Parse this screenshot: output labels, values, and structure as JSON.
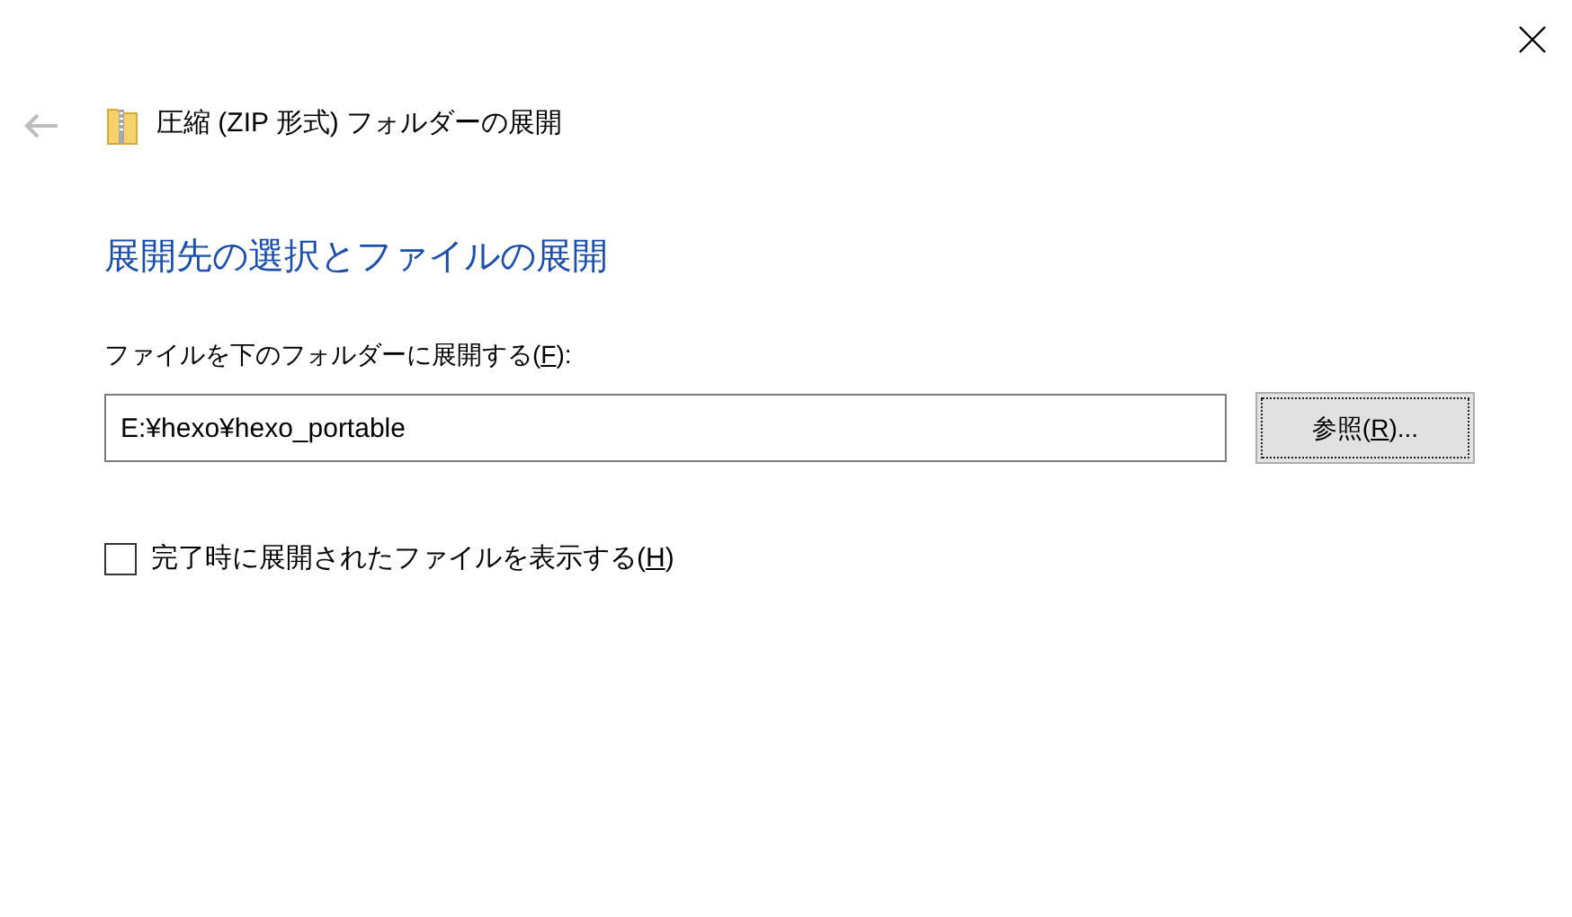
{
  "window": {
    "title": "圧縮 (ZIP 形式) フォルダーの展開"
  },
  "heading": "展開先の選択とファイルの展開",
  "destination": {
    "label": {
      "before": "ファイルを下のフォルダーに展開する(",
      "key": "F",
      "after": "):"
    },
    "value": "E:¥hexo¥hexo_portable"
  },
  "browse_button": {
    "before": "参照(",
    "key": "R",
    "after": ")...",
    "focused": true
  },
  "show_files": {
    "label": {
      "before": "完了時に展開されたファイルを表示する(",
      "key": "H",
      "after": ")"
    },
    "checked": false
  }
}
